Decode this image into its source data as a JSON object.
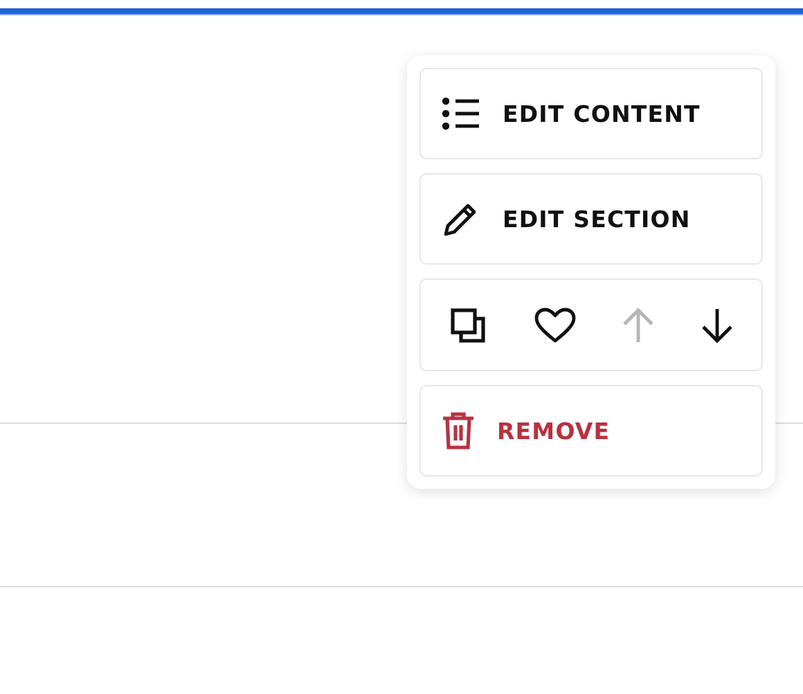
{
  "menu": {
    "items": [
      {
        "kind": "content",
        "label": "EDIT CONTENT"
      },
      {
        "kind": "section",
        "label": "EDIT SECTION"
      },
      {
        "kind": "tools",
        "tools": [
          {
            "kind": "duplicate",
            "disabled": false
          },
          {
            "kind": "favorite",
            "disabled": false
          },
          {
            "kind": "up",
            "disabled": true
          },
          {
            "kind": "down",
            "disabled": false
          }
        ]
      },
      {
        "kind": "remove",
        "label": "REMOVE"
      }
    ]
  }
}
